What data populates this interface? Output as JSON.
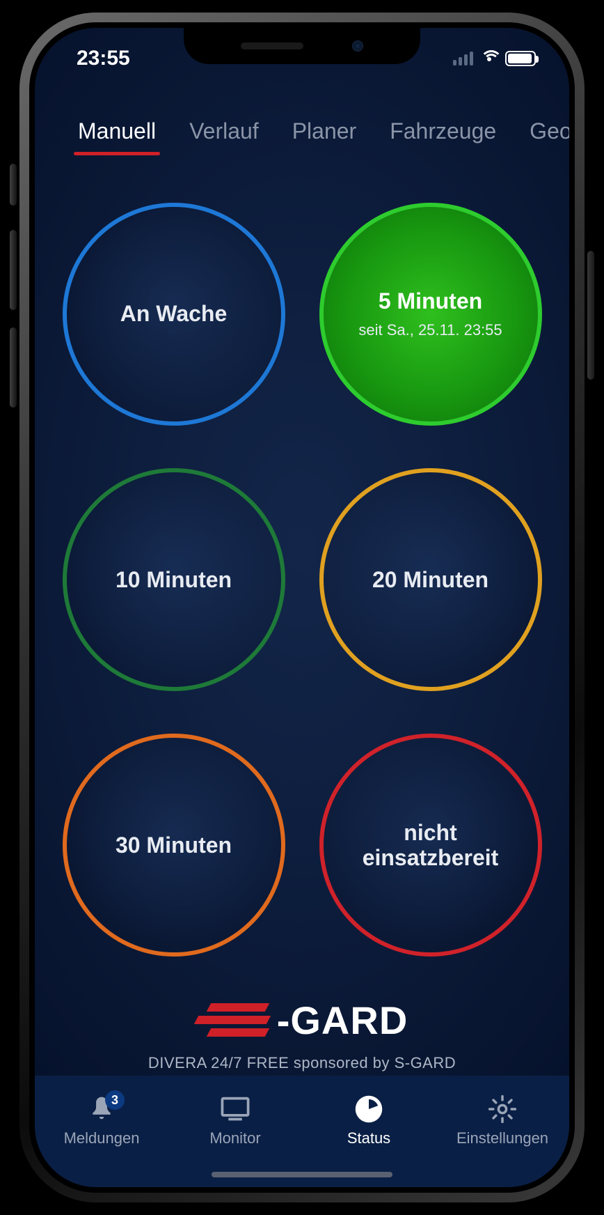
{
  "statusbar": {
    "time": "23:55"
  },
  "tabs": [
    {
      "label": "Manuell",
      "active": true
    },
    {
      "label": "Verlauf",
      "active": false
    },
    {
      "label": "Planer",
      "active": false
    },
    {
      "label": "Fahrzeuge",
      "active": false
    },
    {
      "label": "Geofer",
      "active": false
    }
  ],
  "status_options": [
    {
      "title": "An Wache",
      "sub": "",
      "border": "#1e78d6",
      "selected": false
    },
    {
      "title": "5 Minuten",
      "sub": "seit Sa., 25.11. 23:55",
      "border": "#2ecc2e",
      "selected": true
    },
    {
      "title": "10 Minuten",
      "sub": "",
      "border": "#1e7a38",
      "selected": false
    },
    {
      "title": "20 Minuten",
      "sub": "",
      "border": "#e0a120",
      "selected": false
    },
    {
      "title": "30 Minuten",
      "sub": "",
      "border": "#e06a1e",
      "selected": false
    },
    {
      "title": "nicht einsatzbereit",
      "sub": "",
      "border": "#d0222a",
      "selected": false
    }
  ],
  "sponsor": {
    "brand_prefix": "-",
    "brand": "GARD",
    "tagline": "DIVERA 24/7 FREE sponsored by S-GARD"
  },
  "nav": [
    {
      "icon": "bell",
      "label": "Meldungen",
      "badge": "3",
      "active": false
    },
    {
      "icon": "monitor",
      "label": "Monitor",
      "badge": "",
      "active": false
    },
    {
      "icon": "clock",
      "label": "Status",
      "badge": "",
      "active": true
    },
    {
      "icon": "gear",
      "label": "Einstellungen",
      "badge": "",
      "active": false
    }
  ]
}
